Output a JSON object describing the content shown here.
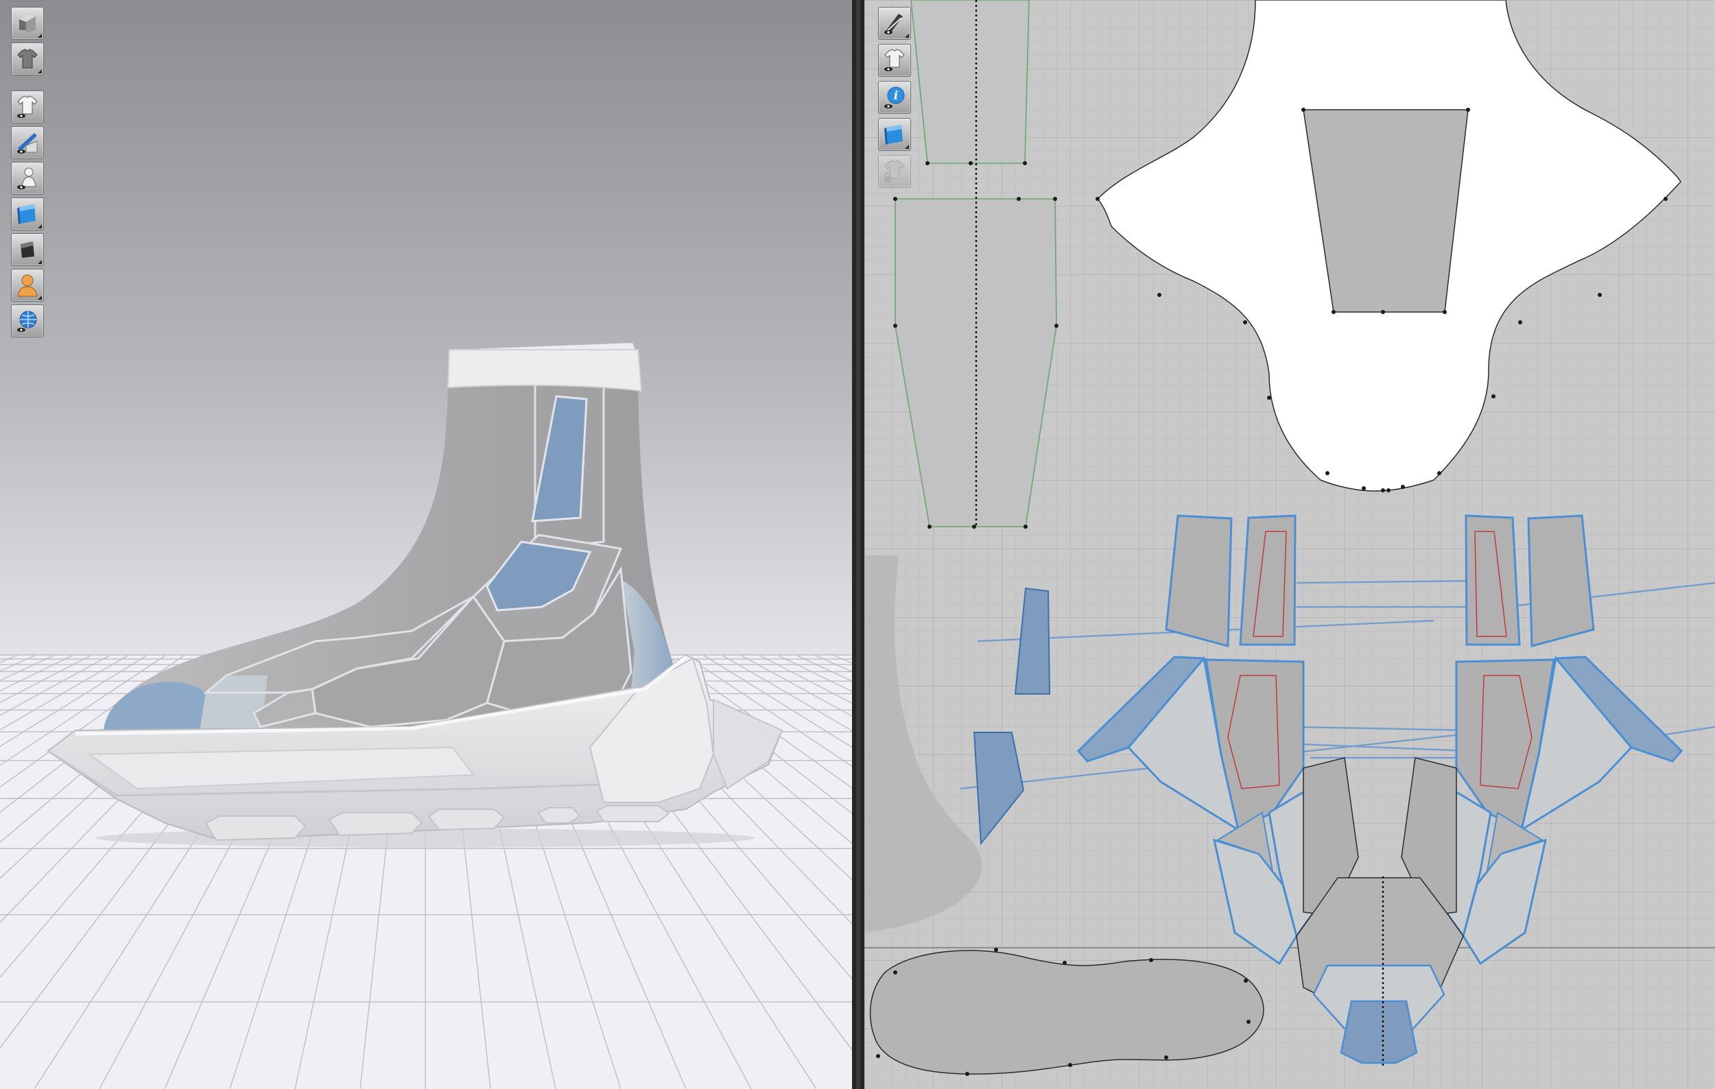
{
  "app": {
    "panes": [
      "3d-viewport",
      "2d-pattern-window"
    ]
  },
  "toolbar_3d": [
    {
      "icon": "avatar-display-icon"
    },
    {
      "icon": "garment-display-icon"
    },
    {
      "icon": "show-garment-icon"
    },
    {
      "icon": "show-internal-lines-icon"
    },
    {
      "icon": "show-avatar-icon"
    },
    {
      "icon": "fabric-texture-mode-icon"
    },
    {
      "icon": "solid-render-mode-icon"
    },
    {
      "icon": "avatar-skin-icon"
    },
    {
      "icon": "grid-environment-icon"
    }
  ],
  "toolbar_2d": [
    {
      "icon": "pattern-display-icon",
      "enabled": true
    },
    {
      "icon": "show-pattern-icon",
      "enabled": true
    },
    {
      "icon": "info-icon",
      "enabled": true
    },
    {
      "icon": "fabric-texture-2d-icon",
      "enabled": true
    },
    {
      "icon": "lock-garment-icon",
      "enabled": false
    }
  ],
  "colors": {
    "sky_top": "#8d8d91",
    "sky_bottom": "#efeff3",
    "floor": "#f0f0f4",
    "floor_grid": "#bdbdc6",
    "upper_gray": "#a9a9ab",
    "accent_blue": "#7e9bbd",
    "sole_white": "#e6e7e9",
    "pattern_bg": "#c9c9c9",
    "pattern_grid": "#b7b7b7",
    "pattern_fill": "#b2b2b2",
    "pattern_light": "#cdd2d4",
    "selected_outline": "#4a8ed4",
    "internal_line": "#c03a3a",
    "seam_connector": "#6e99cc"
  }
}
